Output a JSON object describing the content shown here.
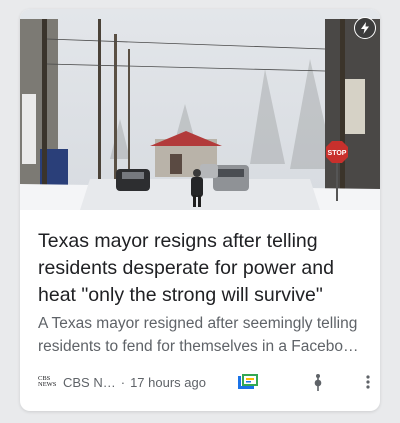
{
  "article": {
    "headline": "Texas mayor resigns after telling residents desperate for power and heat \"only the strong will survive\"",
    "snippet": "A Texas mayor resigned after seemingly telling residents to fend for themselves in a Facebo…",
    "source_logo_text": [
      "CBS",
      "NEWS"
    ],
    "source": "CBS N…",
    "separator": "·",
    "time": "17 hours ago"
  },
  "image_text": {
    "stop_sign": "STOP"
  },
  "icons": {
    "amp": "lightning-bolt-icon",
    "full_coverage": "full-coverage-icon",
    "share": "share-icon",
    "more": "more-vert-icon"
  },
  "colors": {
    "full_coverage_blue": "#1a73e8",
    "full_coverage_green": "#34a853",
    "full_coverage_yellow": "#fbbc04",
    "stop_red": "#c8302c"
  }
}
